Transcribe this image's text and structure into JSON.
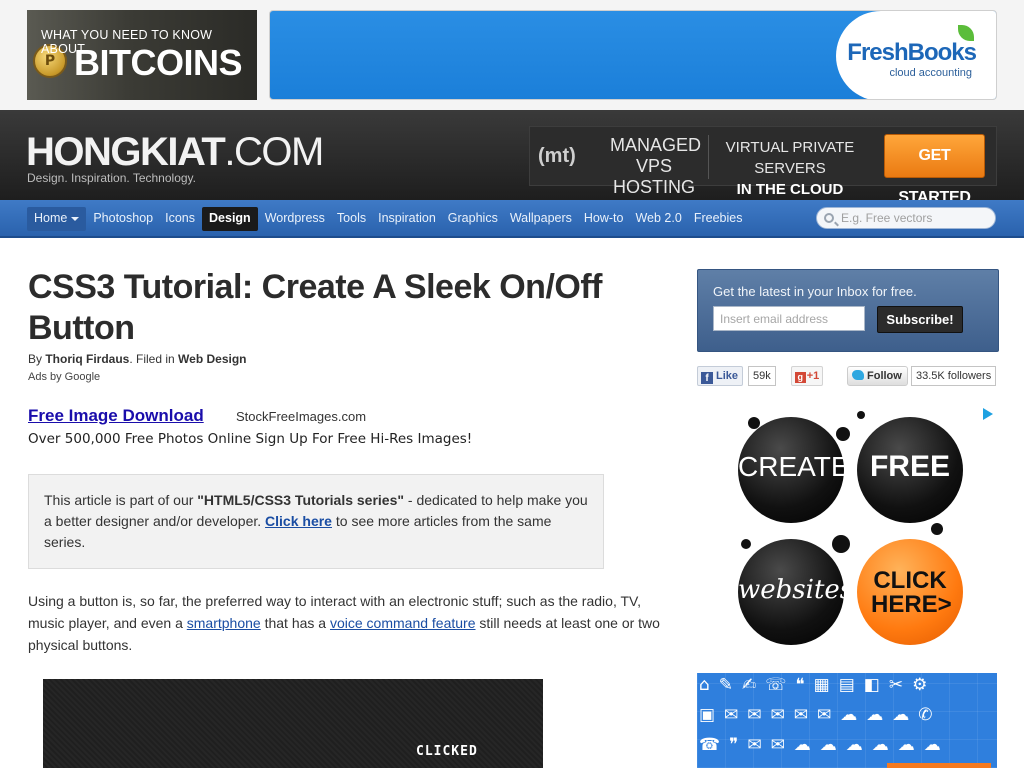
{
  "top_ads": {
    "bitcoin_line1": "WHAT YOU NEED TO KNOW ABOUT",
    "bitcoin_line2": "BITCOINS",
    "bitcoin_coin": "P",
    "freshbooks_name": "FreshBooks",
    "freshbooks_sub": "cloud accounting"
  },
  "header": {
    "logo_main": "HONGKIAT",
    "logo_suffix": ".COM",
    "tagline": "Design. Inspiration. Technology.",
    "vps_ad": {
      "logo": "(mt)",
      "managed_line1": "MANAGED",
      "managed_line2": "VPS HOSTING",
      "vps_line1": "VIRTUAL PRIVATE SERVERS",
      "vps_line2": "IN THE CLOUD",
      "cta": "GET STARTED"
    }
  },
  "nav": {
    "items": [
      "Home",
      "Photoshop",
      "Icons",
      "Design",
      "Wordpress",
      "Tools",
      "Inspiration",
      "Graphics",
      "Wallpapers",
      "How-to",
      "Web 2.0",
      "Freebies"
    ],
    "active": "Design",
    "search_placeholder": "E.g. Free vectors"
  },
  "article": {
    "title": "CSS3 Tutorial: Create A Sleek On/Off Button",
    "byline_prefix": "By ",
    "author": "Thoriq Firdaus",
    "filed_in": ". Filed in ",
    "category": "Web Design",
    "ads_by": "Ads by Google",
    "ad_title": "Free Image Download",
    "ad_url": "StockFreeImages.com",
    "ad_desc": "Over 500,000 Free Photos Online Sign Up For Free Hi-Res Images!",
    "series_pre": "This article is part of our ",
    "series_name": "\"HTML5/CSS3 Tutorials series\"",
    "series_mid": " - dedicated to help make you a better designer and/or developer. ",
    "series_link": "Click here",
    "series_post": " to see more articles from the same series.",
    "para_pre": "Using a button is, so far, the preferred way to interact with an electronic stuff; such as the radio, TV, music player, and even a ",
    "para_link1": "smartphone",
    "para_mid": " that has a ",
    "para_link2": "voice command feature",
    "para_post": " still needs at least one or two physical buttons.",
    "preview_label": "CLICKED"
  },
  "sidebar": {
    "newsletter_title": "Get the latest in your Inbox for free.",
    "email_placeholder": "Insert email address",
    "subscribe": "Subscribe!",
    "fb_like": "Like",
    "fb_count": "59k",
    "gplus": "+1",
    "tw_follow": "Follow",
    "tw_count": "33.5K followers",
    "ad_balls": [
      "CREATE",
      "FREE",
      "websites",
      "CLICK HERE>"
    ]
  },
  "colors": {
    "nav_blue": "#2a62ad",
    "header_dark": "#1e1e1e",
    "link_blue": "#1a4da3",
    "cta_orange": "#ea7a12"
  }
}
